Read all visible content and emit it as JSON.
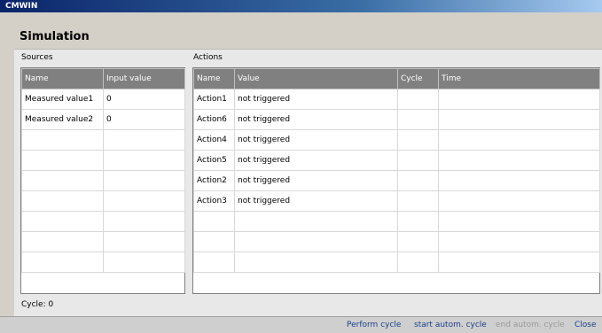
{
  "window": {
    "title": "CMWIN"
  },
  "page": {
    "heading": "Simulation"
  },
  "sources": {
    "label": "Sources",
    "columns": [
      "Name",
      "Input value"
    ],
    "rows": [
      [
        "Measured value1",
        "0"
      ],
      [
        "Measured value2",
        "0"
      ],
      [
        "",
        ""
      ],
      [
        "",
        ""
      ],
      [
        "",
        ""
      ],
      [
        "",
        ""
      ],
      [
        "",
        ""
      ],
      [
        "",
        ""
      ],
      [
        "",
        ""
      ]
    ]
  },
  "actions": {
    "label": "Actions",
    "columns": [
      "Name",
      "Value",
      "Cycle",
      "Time"
    ],
    "rows": [
      [
        "Action1",
        "not triggered",
        "",
        ""
      ],
      [
        "Action6",
        "not triggered",
        "",
        ""
      ],
      [
        "Action4",
        "not triggered",
        "",
        ""
      ],
      [
        "Action5",
        "not triggered",
        "",
        ""
      ],
      [
        "Action2",
        "not triggered",
        "",
        ""
      ],
      [
        "Action3",
        "not triggered",
        "",
        ""
      ],
      [
        "",
        "",
        "",
        ""
      ],
      [
        "",
        "",
        "",
        ""
      ],
      [
        "",
        "",
        "",
        ""
      ]
    ]
  },
  "status": {
    "cycle": "Cycle: 0"
  },
  "buttons": {
    "perform_cycle": "Perform cycle",
    "start_autom_cycle": "start autom. cycle",
    "end_autom_cycle": "end autom. cycle",
    "close": "Close"
  }
}
